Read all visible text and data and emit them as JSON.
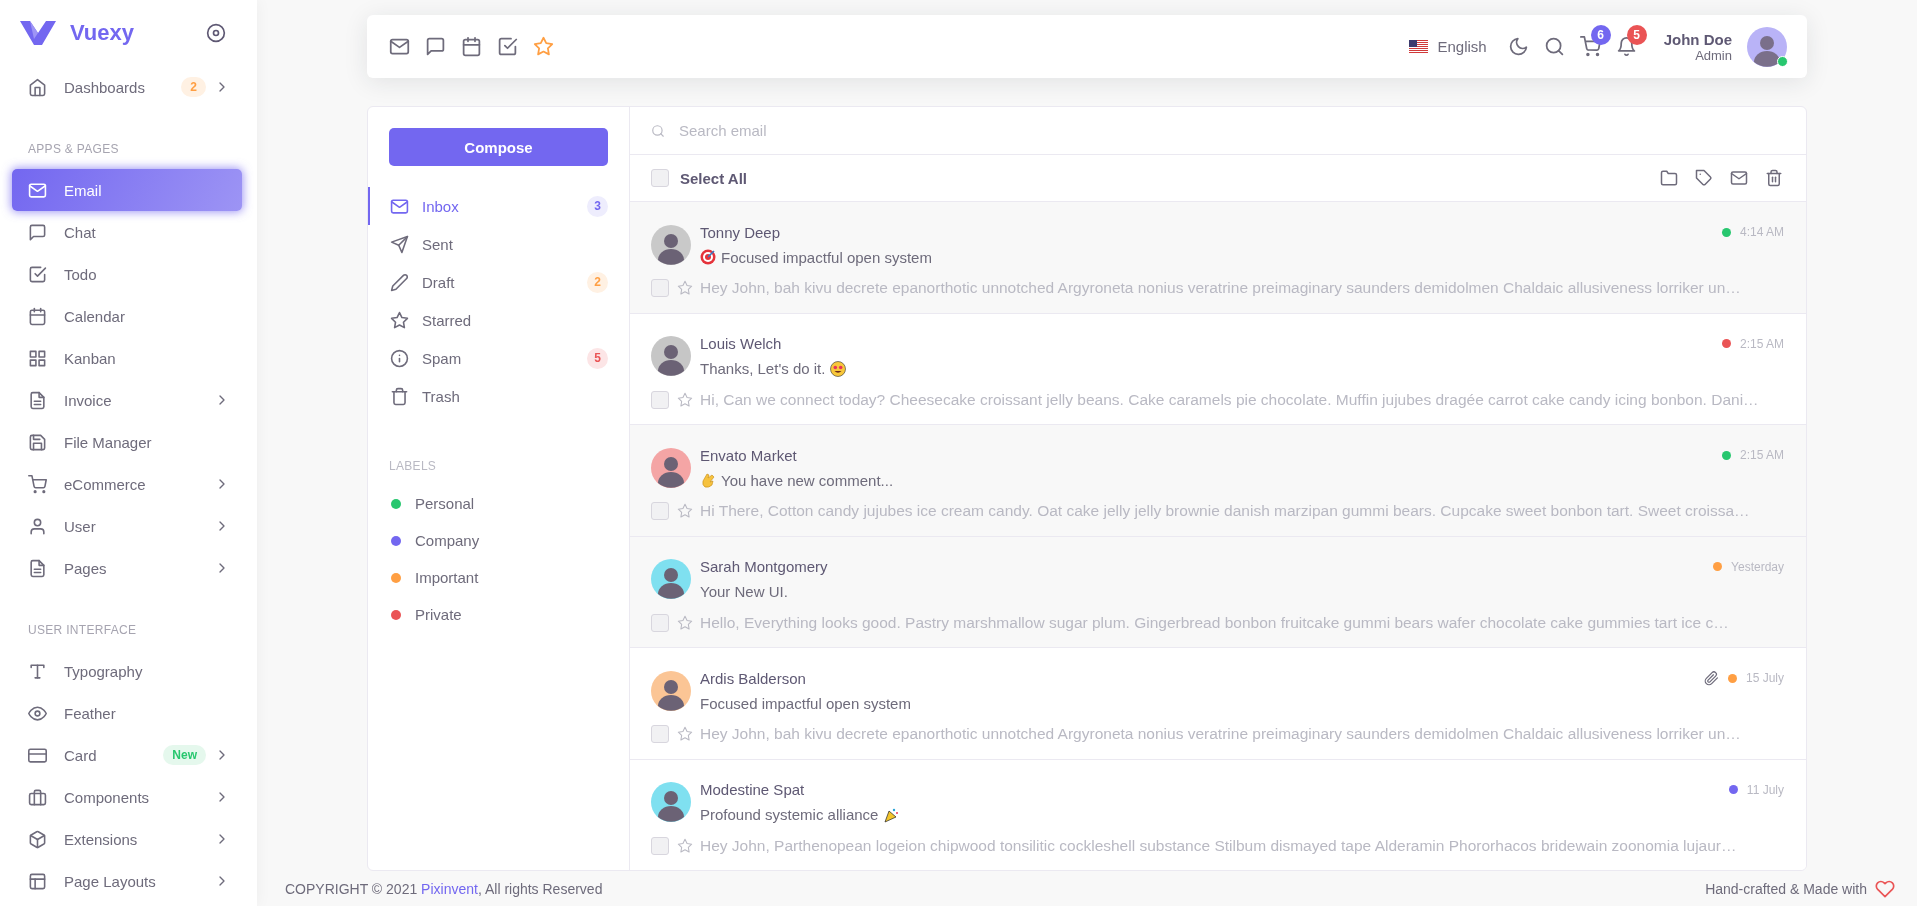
{
  "sidebar": {
    "brand": "Vuexy",
    "sections": [
      {
        "items": [
          {
            "label": "Dashboards",
            "selected": false,
            "expandable": true,
            "badge": {
              "text": "2",
              "kind": "warning"
            }
          }
        ]
      },
      {
        "heading": "APPS & PAGES",
        "items": [
          {
            "label": "Email",
            "selected": true,
            "expandable": false
          },
          {
            "label": "Chat",
            "selected": false,
            "expandable": false
          },
          {
            "label": "Todo",
            "selected": false,
            "expandable": false
          },
          {
            "label": "Calendar",
            "selected": false,
            "expandable": false
          },
          {
            "label": "Kanban",
            "selected": false,
            "expandable": false
          },
          {
            "label": "Invoice",
            "selected": false,
            "expandable": true
          },
          {
            "label": "File Manager",
            "selected": false,
            "expandable": false
          },
          {
            "label": "eCommerce",
            "selected": false,
            "expandable": true
          },
          {
            "label": "User",
            "selected": false,
            "expandable": true
          },
          {
            "label": "Pages",
            "selected": false,
            "expandable": true
          }
        ]
      },
      {
        "heading": "USER INTERFACE",
        "items": [
          {
            "label": "Typography",
            "selected": false,
            "expandable": false
          },
          {
            "label": "Feather",
            "selected": false,
            "expandable": false
          },
          {
            "label": "Card",
            "selected": false,
            "expandable": true,
            "badge": {
              "text": "New",
              "kind": "success"
            }
          },
          {
            "label": "Components",
            "selected": false,
            "expandable": true
          },
          {
            "label": "Extensions",
            "selected": false,
            "expandable": true
          },
          {
            "label": "Page Layouts",
            "selected": false,
            "expandable": true
          }
        ]
      }
    ]
  },
  "navbar": {
    "language": "English",
    "cart_count": "6",
    "notification_count": "5",
    "user_name": "John Doe",
    "user_role": "Admin",
    "online": true
  },
  "mail_app": {
    "compose": "Compose",
    "search": {
      "placeholder": "Search email"
    },
    "select_all": {
      "label": "Select All",
      "checked": false
    },
    "folders": [
      {
        "label": "Inbox",
        "selected": true,
        "count": {
          "text": "3",
          "kind": "primary"
        }
      },
      {
        "label": "Sent",
        "selected": false
      },
      {
        "label": "Draft",
        "selected": false,
        "count": {
          "text": "2",
          "kind": "warning"
        }
      },
      {
        "label": "Starred",
        "selected": false
      },
      {
        "label": "Spam",
        "selected": false,
        "count": {
          "text": "5",
          "kind": "danger"
        }
      },
      {
        "label": "Trash",
        "selected": false
      }
    ],
    "labels_heading": "LABELS",
    "labels": [
      {
        "label": "Personal",
        "color": "#28c76f"
      },
      {
        "label": "Company",
        "color": "#7367f0"
      },
      {
        "label": "Important",
        "color": "#ff9f43"
      },
      {
        "label": "Private",
        "color": "#ea5455"
      }
    ],
    "emails": [
      {
        "sender": "Tonny Deep",
        "subject": "Focused impactful open system",
        "icon_before_subject": {
          "kind": "target"
        },
        "preview": "Hey John, bah kivu decrete epanorthotic unnotched Argyroneta nonius veratrine preimaginary saunders demidolmen Chaldaic allusiveness lorriker un…",
        "time": "4:14 AM",
        "color": "#28c76f",
        "read": true,
        "attachment": false,
        "checked": false,
        "starred": false
      },
      {
        "sender": "Louis Welch",
        "subject": "Thanks, Let's do it.",
        "icon_after_subject": {
          "kind": "star-eyes"
        },
        "preview": "Hi, Can we connect today? Cheesecake croissant jelly beans. Cake caramels pie chocolate. Muffin jujubes dragée carrot cake candy icing bonbon. Dani…",
        "time": "2:15 AM",
        "color": "#ea5455",
        "read": false,
        "attachment": false,
        "checked": false,
        "starred": false
      },
      {
        "sender": "Envato Market",
        "subject": "You have new comment...",
        "icon_before_subject": {
          "kind": "clap"
        },
        "preview": "Hi There, Cotton candy jujubes ice cream candy. Oat cake jelly jelly brownie danish marzipan gummi bears. Cupcake sweet bonbon tart. Sweet croissa…",
        "time": "2:15 AM",
        "color": "#28c76f",
        "read": true,
        "attachment": false,
        "checked": false,
        "starred": false
      },
      {
        "sender": "Sarah Montgomery",
        "subject": "Your New UI.",
        "preview": "Hello, Everything looks good. Pastry marshmallow sugar plum. Gingerbread bonbon fruitcake gummi bears wafer chocolate cake gummies tart ice c…",
        "time": "Yesterday",
        "color": "#ff9f43",
        "read": true,
        "attachment": false,
        "checked": false,
        "starred": false
      },
      {
        "sender": "Ardis Balderson",
        "subject": "Focused impactful open system",
        "preview": "Hey John, bah kivu decrete epanorthotic unnotched Argyroneta nonius veratrine preimaginary saunders demidolmen Chaldaic allusiveness lorriker un…",
        "time": "15 July",
        "color": "#ff9f43",
        "read": false,
        "attachment": true,
        "checked": false,
        "starred": false
      },
      {
        "sender": "Modestine Spat",
        "subject": "Profound systemic alliance",
        "icon_after_subject": {
          "kind": "party"
        },
        "preview": "Hey John, Parthenopean logeion chipwood tonsilitic cockleshell substance Stilbum dismayed tape Alderamin Phororhacos bridewain zoonomia lujaur…",
        "time": "11 July",
        "color": "#7367f0",
        "read": false,
        "attachment": false,
        "checked": false,
        "starred": false
      }
    ]
  },
  "footer": {
    "copyright": "COPYRIGHT © 2021",
    "link": "Pixinvent",
    "copyright_end": ", All rights Reserved",
    "credit": "Hand-crafted & Made with"
  }
}
